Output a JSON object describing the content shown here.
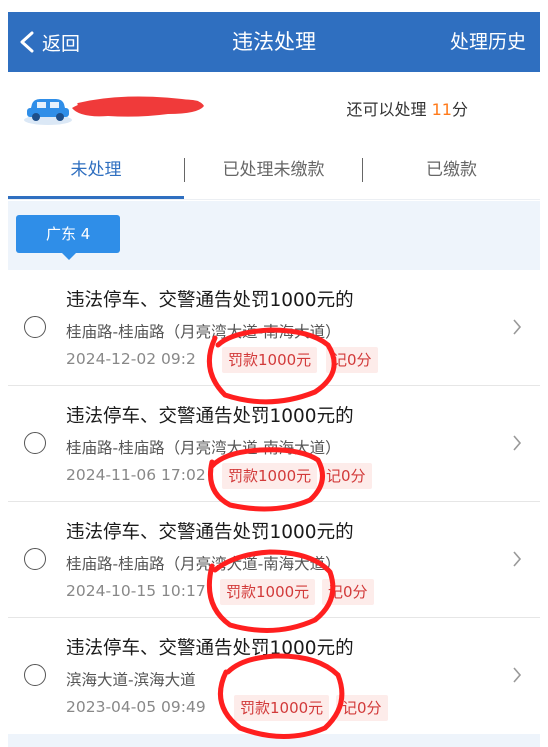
{
  "navbar": {
    "back_label": "返回",
    "title": "违法处理",
    "history_label": "处理历史"
  },
  "vehicle": {
    "points_prefix": "还可以处理",
    "points_value": "11",
    "points_suffix": "分"
  },
  "tabs": [
    {
      "label": "未处理",
      "active": true
    },
    {
      "label": "已处理未缴款",
      "active": false
    },
    {
      "label": "已缴款",
      "active": false
    }
  ],
  "region": {
    "label": "广东 4"
  },
  "violations": [
    {
      "title": "违法停车、交警通告处罚1000元的",
      "location": "桂庙路-桂庙路（月亮湾大道-南海大道）",
      "time": "2024-12-02 09:2",
      "fine": "罚款1000元",
      "points": "记0分"
    },
    {
      "title": "违法停车、交警通告处罚1000元的",
      "location": "桂庙路-桂庙路（月亮湾大道-南海大道）",
      "time": "2024-11-06 17:02",
      "fine": "罚款1000元",
      "points": "记0分"
    },
    {
      "title": "违法停车、交警通告处罚1000元的",
      "location": "桂庙路-桂庙路（月亮湾大道-南海大道）",
      "time": "2024-10-15 10:17",
      "fine": "罚款1000元",
      "points": "记0分"
    },
    {
      "title": "违法停车、交警通告处罚1000元的",
      "location": "滨海大道-滨海大道",
      "time": "2023-04-05 09:49",
      "fine": "罚款1000元",
      "points": "记0分"
    }
  ],
  "colors": {
    "nav_blue": "#2f6fc0",
    "badge_blue": "#2f8ee8",
    "fine_red": "#d23a3a",
    "points_orange": "#ff7a1a",
    "annotation_red": "#ff1f1f"
  },
  "icons": {
    "back": "chevron-left-icon",
    "car": "car-icon",
    "row_arrow": "chevron-right-icon"
  }
}
